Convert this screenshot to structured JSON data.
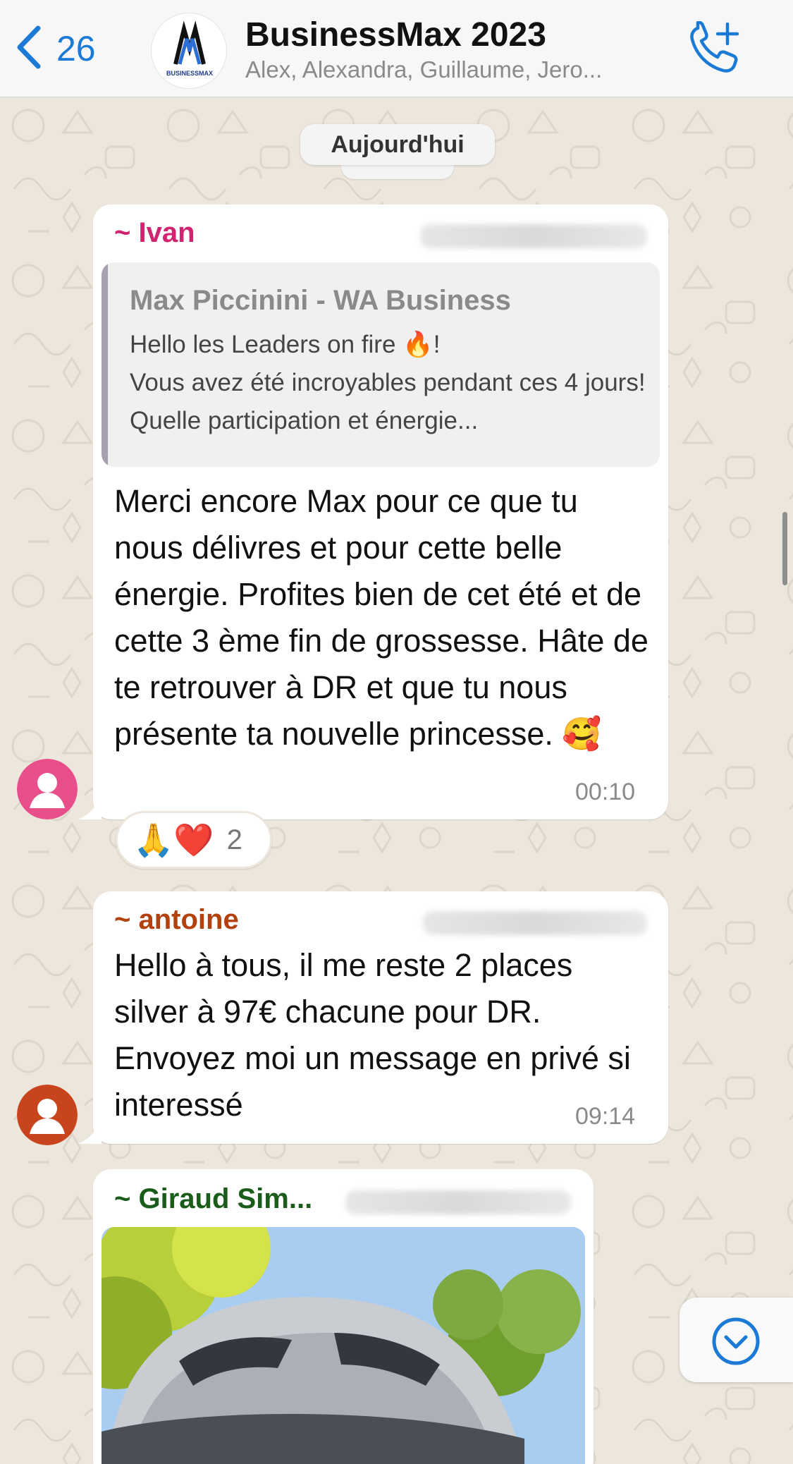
{
  "header": {
    "back_count": "26",
    "group_name": "BusinessMax 2023",
    "members": "Alex, Alexandra, Guillaume, Jero...",
    "avatar_text": "BUSINESSMAX"
  },
  "date_separator": "Aujourd'hui",
  "messages": [
    {
      "sender": "~ Ivan",
      "sender_color": "#d1236f",
      "quote": {
        "author": "Max Piccinini - WA Business",
        "text": "Hello les Leaders on fire 🔥!\nVous avez été incroyables pendant ces 4 jours! Quelle participation et énergie..."
      },
      "text": "Merci encore Max pour ce que tu nous délivres et pour cette belle énergie. Profites bien de cet été et de cette 3 ème fin de grossesse. Hâte de te retrouver à DR et que tu nous présente ta nouvelle princesse. 🥰",
      "time": "00:10",
      "reactions": {
        "emojis": "🙏❤️",
        "count": "2"
      }
    },
    {
      "sender": "~ antoine",
      "sender_color": "#b3410e",
      "text": "Hello à tous, il me reste 2 places silver à 97€ chacune pour DR. Envoyez moi un message en privé si interessé",
      "time": "09:14"
    },
    {
      "sender": "~ Giraud Sim...",
      "sender_color": "#1a5c1a"
    }
  ],
  "colors": {
    "accent": "#1a7ad6",
    "ivan_avatar": "#e84f8a",
    "antoine_avatar": "#c8441c"
  },
  "icons": {
    "back": "chevron-left-icon",
    "call": "add-call-icon",
    "scroll_down": "chevron-down-circle-icon"
  }
}
